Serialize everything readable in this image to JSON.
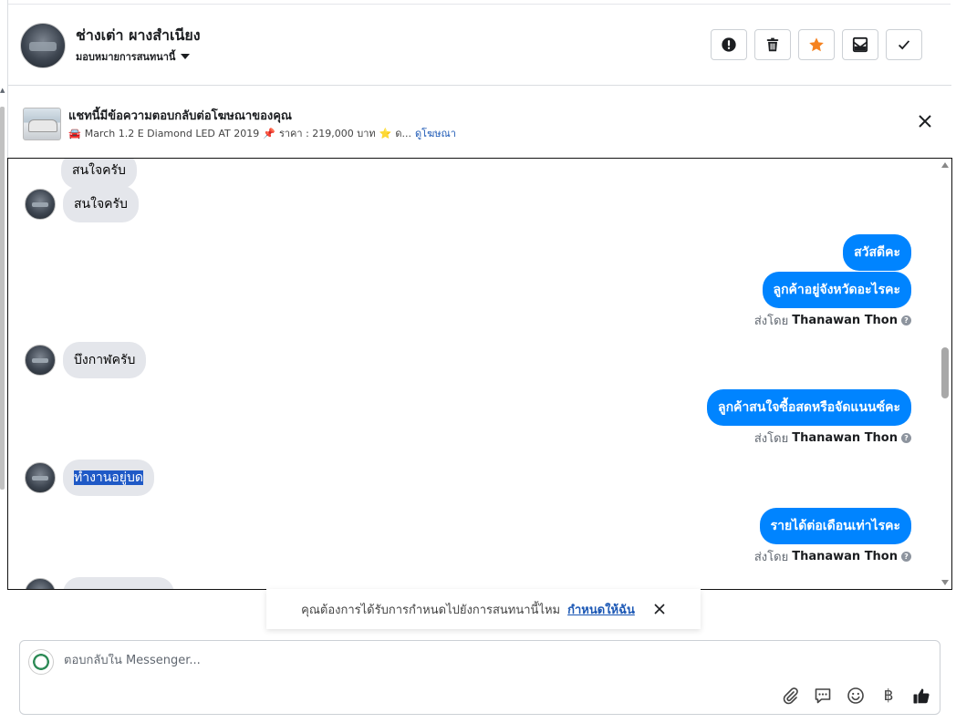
{
  "header": {
    "contact_name": "ช่างเต่า ผางสำเนียง",
    "assign_label": "มอบหมายการสนทนานี้",
    "actions": [
      "report-icon",
      "trash-icon",
      "star-icon",
      "mark-unread-icon",
      "check-icon"
    ],
    "star_color": "#f58220"
  },
  "ad": {
    "title": "แชทนี้มีข้อความตอบกลับต่อโฆษณาของคุณ",
    "car_emoji": "🚘",
    "detail": "March 1.2 E Diamond LED AT 2019",
    "pin_emoji": "📌",
    "price": "ราคา : 219,000 บาท",
    "star_emoji": "⭐",
    "truncated": "ด...",
    "link": "ดูโฆษณา"
  },
  "messages": [
    {
      "side": "in",
      "text": "สนใจครับ",
      "partial": true
    },
    {
      "side": "in",
      "text": "สนใจครับ"
    },
    {
      "side": "out",
      "text": "สวัสดีคะ"
    },
    {
      "side": "out",
      "text": "ลูกค้าอยู่จังหวัดอะไรคะ"
    },
    {
      "side": "in",
      "text": "บึงกาฬครับ"
    },
    {
      "side": "out",
      "text": "ลูกค้าสนใจซื้อสดหรือจัดแนนซ์คะ"
    },
    {
      "side": "in",
      "text": "ทำงานอยู่บด",
      "selected": true
    },
    {
      "side": "out",
      "text": "รายได้ต่อเดือนเท่าไรคะ"
    }
  ],
  "sent_by": {
    "prefix": "ส่งโดย",
    "name": "Thanawan Thon",
    "help": "?"
  },
  "notice": {
    "text": "คุณต้องการได้รับการกำหนดไปยังการสนทนานี้ไหม",
    "link": "กำหนดให้ฉัน"
  },
  "composer": {
    "placeholder": "ตอบกลับใน Messenger...",
    "value": "",
    "tools": [
      "attach-icon",
      "saved-reply-icon",
      "emoji-icon",
      "payment-icon",
      "like-icon"
    ],
    "payment_symbol": "฿"
  },
  "colors": {
    "accent": "#0084ff",
    "link": "#1c58b5",
    "bubble_in": "#e4e6eb",
    "highlight": "#1f59c6"
  }
}
